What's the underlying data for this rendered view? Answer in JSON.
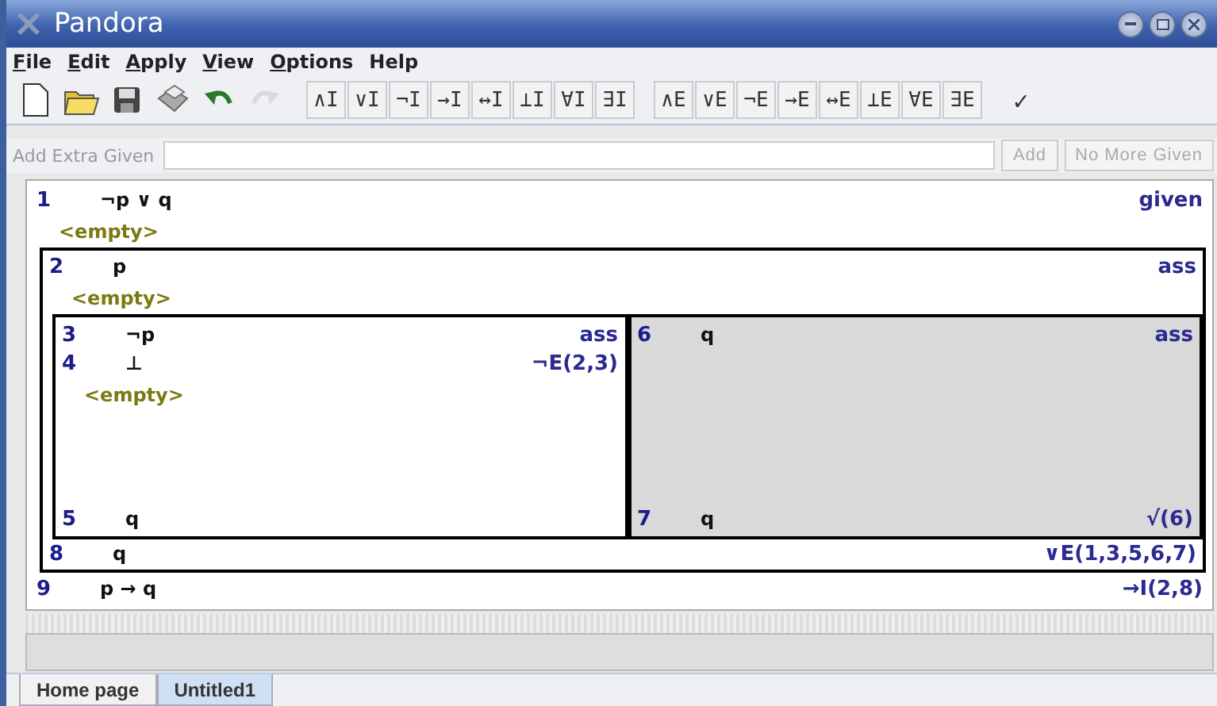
{
  "window": {
    "title": "Pandora"
  },
  "menu": [
    {
      "label": "File",
      "underline_first": true
    },
    {
      "label": "Edit",
      "underline_first": true
    },
    {
      "label": "Apply",
      "underline_first": true
    },
    {
      "label": "View",
      "underline_first": true
    },
    {
      "label": "Options",
      "underline_first": true
    },
    {
      "label": "Help",
      "underline_first": false
    }
  ],
  "file_tools": [
    {
      "kind": "new",
      "disabled": false
    },
    {
      "kind": "open",
      "disabled": false
    },
    {
      "kind": "save",
      "disabled": false
    },
    {
      "kind": "print",
      "disabled": false
    },
    {
      "kind": "undo",
      "disabled": false
    },
    {
      "kind": "redo",
      "disabled": true
    }
  ],
  "intro_rules": [
    "∧I",
    "∨I",
    "¬I",
    "→I",
    "↔I",
    "⊥I",
    "∀I",
    "∃I"
  ],
  "elim_rules": [
    "∧E",
    "∨E",
    "¬E",
    "→E",
    "↔E",
    "⊥E",
    "∀E",
    "∃E"
  ],
  "check_button": "✓",
  "given_bar": {
    "label": "Add Extra Given",
    "add": "Add",
    "done": "No More Given",
    "disabled": true
  },
  "proof": [
    {
      "kind": "line",
      "number": "1",
      "formula": "¬p ∨ q",
      "rule": "given"
    },
    {
      "kind": "empty",
      "text": "<empty>"
    },
    {
      "kind": "box",
      "highlighted": false,
      "children": [
        {
          "kind": "line",
          "number": "2",
          "formula": "p",
          "rule": "ass"
        },
        {
          "kind": "empty",
          "text": "<empty>"
        },
        {
          "kind": "split",
          "boxes": [
            {
              "highlighted": false,
              "children": [
                {
                  "kind": "line",
                  "number": "3",
                  "formula": "¬p",
                  "rule": "ass"
                },
                {
                  "kind": "line",
                  "number": "4",
                  "formula": "⊥",
                  "rule": "¬E(2,3)"
                },
                {
                  "kind": "empty",
                  "text": "<empty>"
                },
                {
                  "kind": "line",
                  "number": "5",
                  "formula": "q"
                }
              ]
            },
            {
              "highlighted": true,
              "children": [
                {
                  "kind": "line",
                  "number": "6",
                  "formula": "q",
                  "rule": "ass"
                },
                {
                  "kind": "line",
                  "number": "7",
                  "formula": "q",
                  "rule": "√(6)"
                }
              ]
            }
          ]
        },
        {
          "kind": "line",
          "number": "8",
          "formula": "q",
          "rule": "∨E(1,3,5,6,7)"
        }
      ]
    },
    {
      "kind": "line",
      "number": "9",
      "formula": "p → q",
      "rule": "→I(2,8)"
    }
  ],
  "tabs": [
    {
      "label": "Home page",
      "selected": false
    },
    {
      "label": "Untitled1",
      "selected": true
    }
  ]
}
